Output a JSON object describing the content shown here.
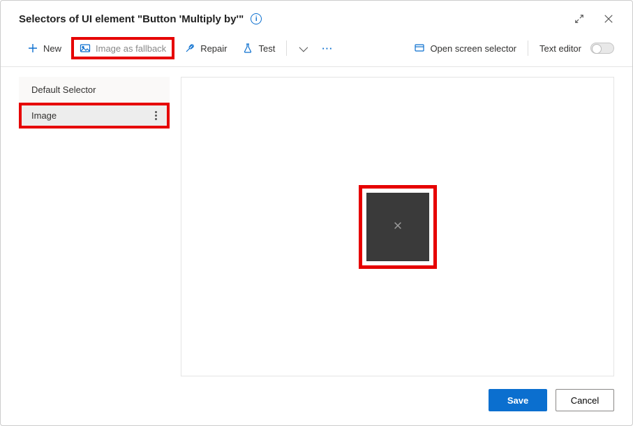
{
  "header": {
    "title": "Selectors of UI element \"Button 'Multiply by'\""
  },
  "toolbar": {
    "new_label": "New",
    "image_fallback_label": "Image as fallback",
    "repair_label": "Repair",
    "test_label": "Test",
    "open_screen_selector_label": "Open screen selector",
    "text_editor_label": "Text editor"
  },
  "sidebar": {
    "items": [
      {
        "label": "Default Selector"
      },
      {
        "label": "Image"
      }
    ]
  },
  "footer": {
    "save_label": "Save",
    "cancel_label": "Cancel"
  }
}
